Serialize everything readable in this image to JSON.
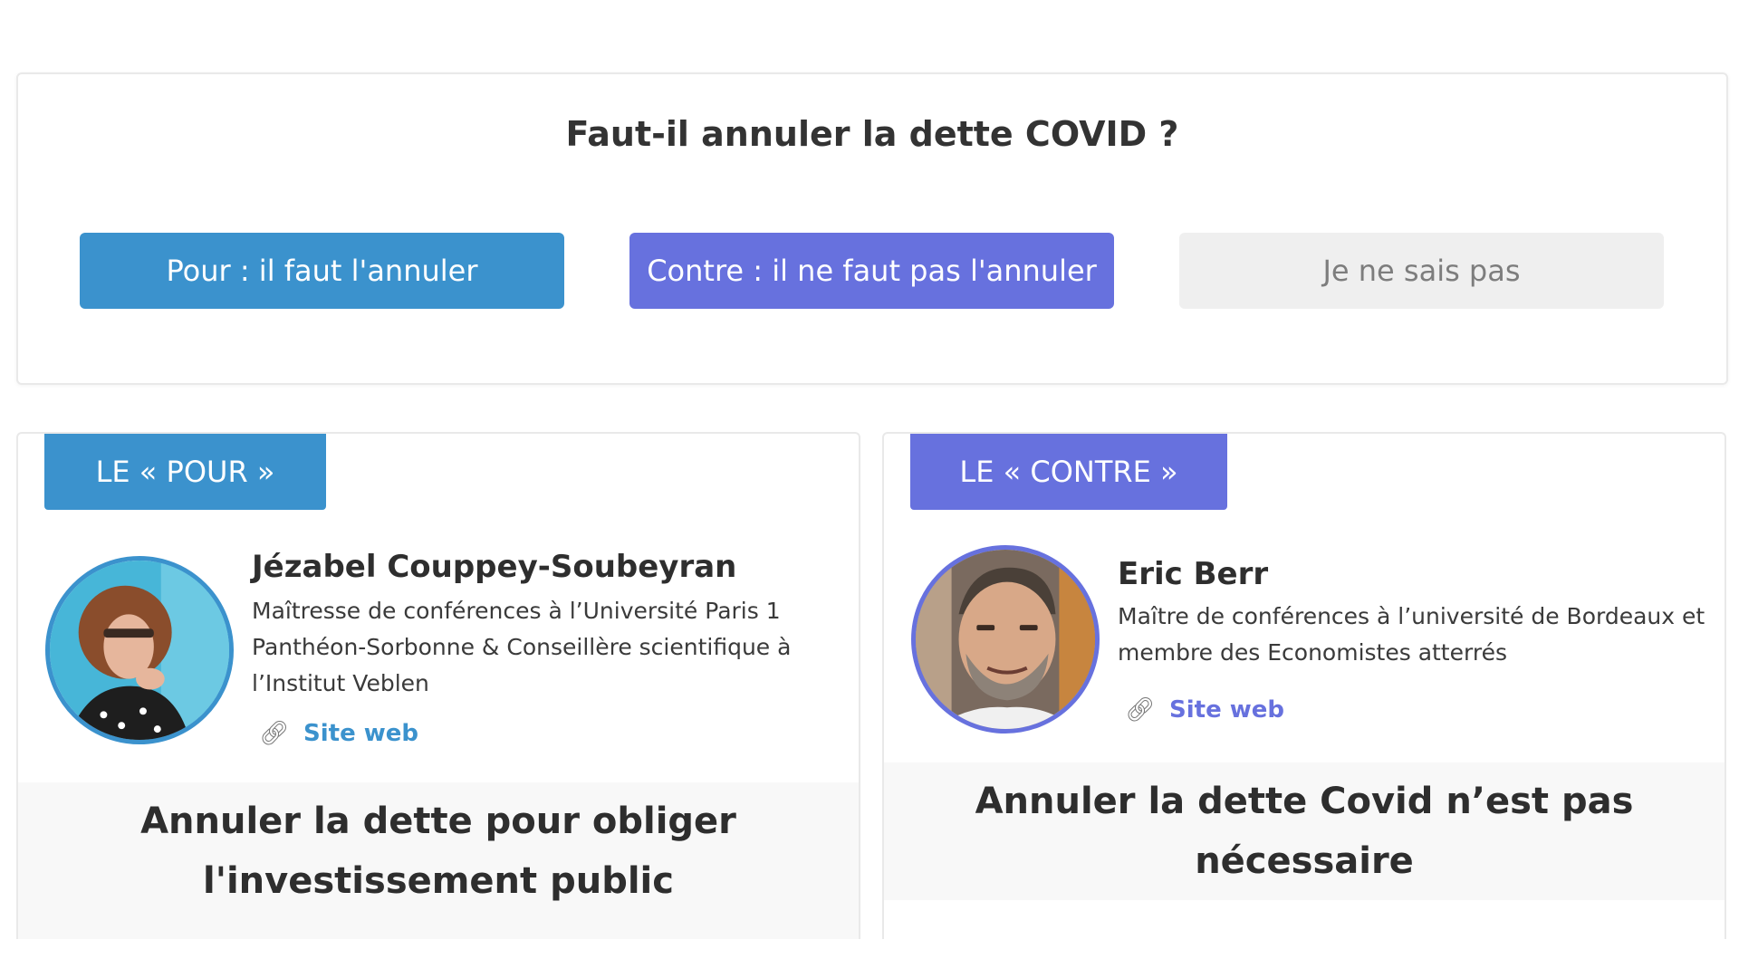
{
  "poll": {
    "question": "Faut-il annuler la dette COVID ?",
    "options": {
      "pour": "Pour : il faut l'annuler",
      "contre": "Contre : il ne faut pas l'annuler",
      "nsp": "Je ne sais pas"
    }
  },
  "pour": {
    "tab_label": "LE « POUR »",
    "name": "Jézabel Couppey-Soubeyran",
    "description": "Maîtresse de conférences à l’Université Paris 1 Panthéon-Sorbonne & Conseillère scientifique à l’Institut Veblen",
    "link_label": "Site web",
    "thesis": "Annuler la dette pour obliger l'investissement public",
    "accent_color": "#3b92cd"
  },
  "contre": {
    "tab_label": "LE « CONTRE »",
    "name": "Eric Berr",
    "description": "Maître de conférences à l’université de Bordeaux et membre des Economistes atterrés",
    "link_label": "Site web",
    "thesis": "Annuler la dette Covid n’est pas nécessaire",
    "accent_color": "#6771de"
  },
  "icons": {
    "link": "link-icon"
  }
}
